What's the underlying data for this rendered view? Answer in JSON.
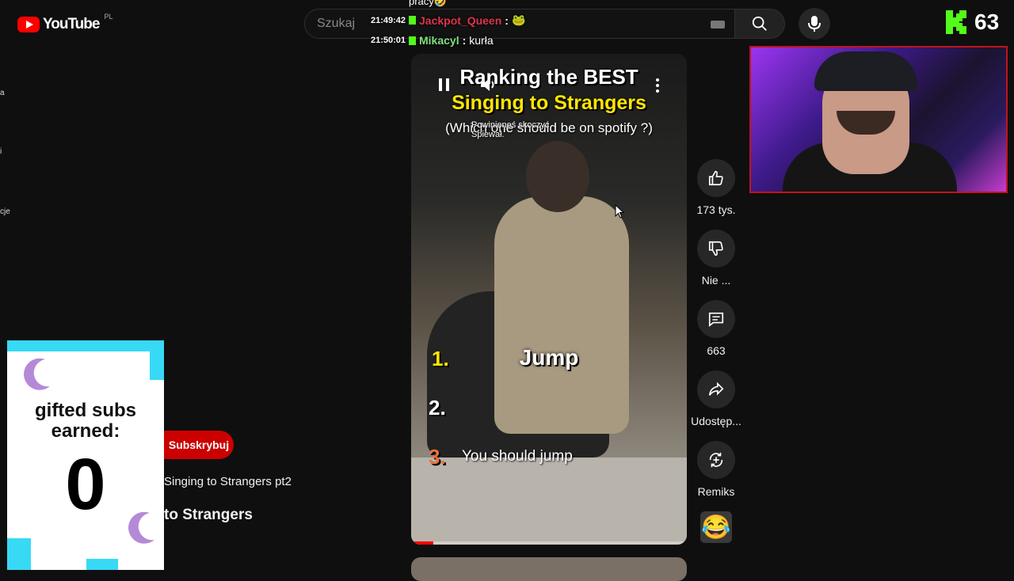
{
  "header": {
    "logo_text": "YouTube",
    "region_code": "PL",
    "search_placeholder": "Szukaj"
  },
  "kick": {
    "viewer_count": "63"
  },
  "chat": {
    "partial_top": "pracy🤣",
    "messages": [
      {
        "time": "21:49:42",
        "user": "Jackpot_Queen",
        "user_color": "#e0334a",
        "message": "🐸"
      },
      {
        "time": "21:50:01",
        "user": "Mikacyl",
        "user_color": "#7ee07e",
        "message": "kurła"
      }
    ]
  },
  "sidebar_fragments": [
    "a",
    "i",
    "cje"
  ],
  "video": {
    "title_line1": "Ranking the BEST",
    "title_line2": "Singing to Strangers",
    "subtitle": "(Which one should be on spotify ?)",
    "donation_text_1": "Powinieneś skoczyć",
    "donation_text_2": "Śpiewał.",
    "ranks": [
      {
        "number": "1.",
        "label": "Jump"
      },
      {
        "number": "2.",
        "label": ""
      },
      {
        "number": "3.",
        "label": "You should jump"
      }
    ],
    "progress": 0.08
  },
  "actions": {
    "like_count": "173 tys.",
    "dislike_label": "Nie ...",
    "comments_count": "663",
    "share_label": "Udostęp...",
    "remix_label": "Remiks"
  },
  "gifted": {
    "title_line1": "gifted subs",
    "title_line2": "earned:",
    "count": "0"
  },
  "channel": {
    "subscribe_label": "Subskrybuj",
    "desc_line": "Singing to Strangers pt2",
    "title_partial": "to Strangers"
  }
}
